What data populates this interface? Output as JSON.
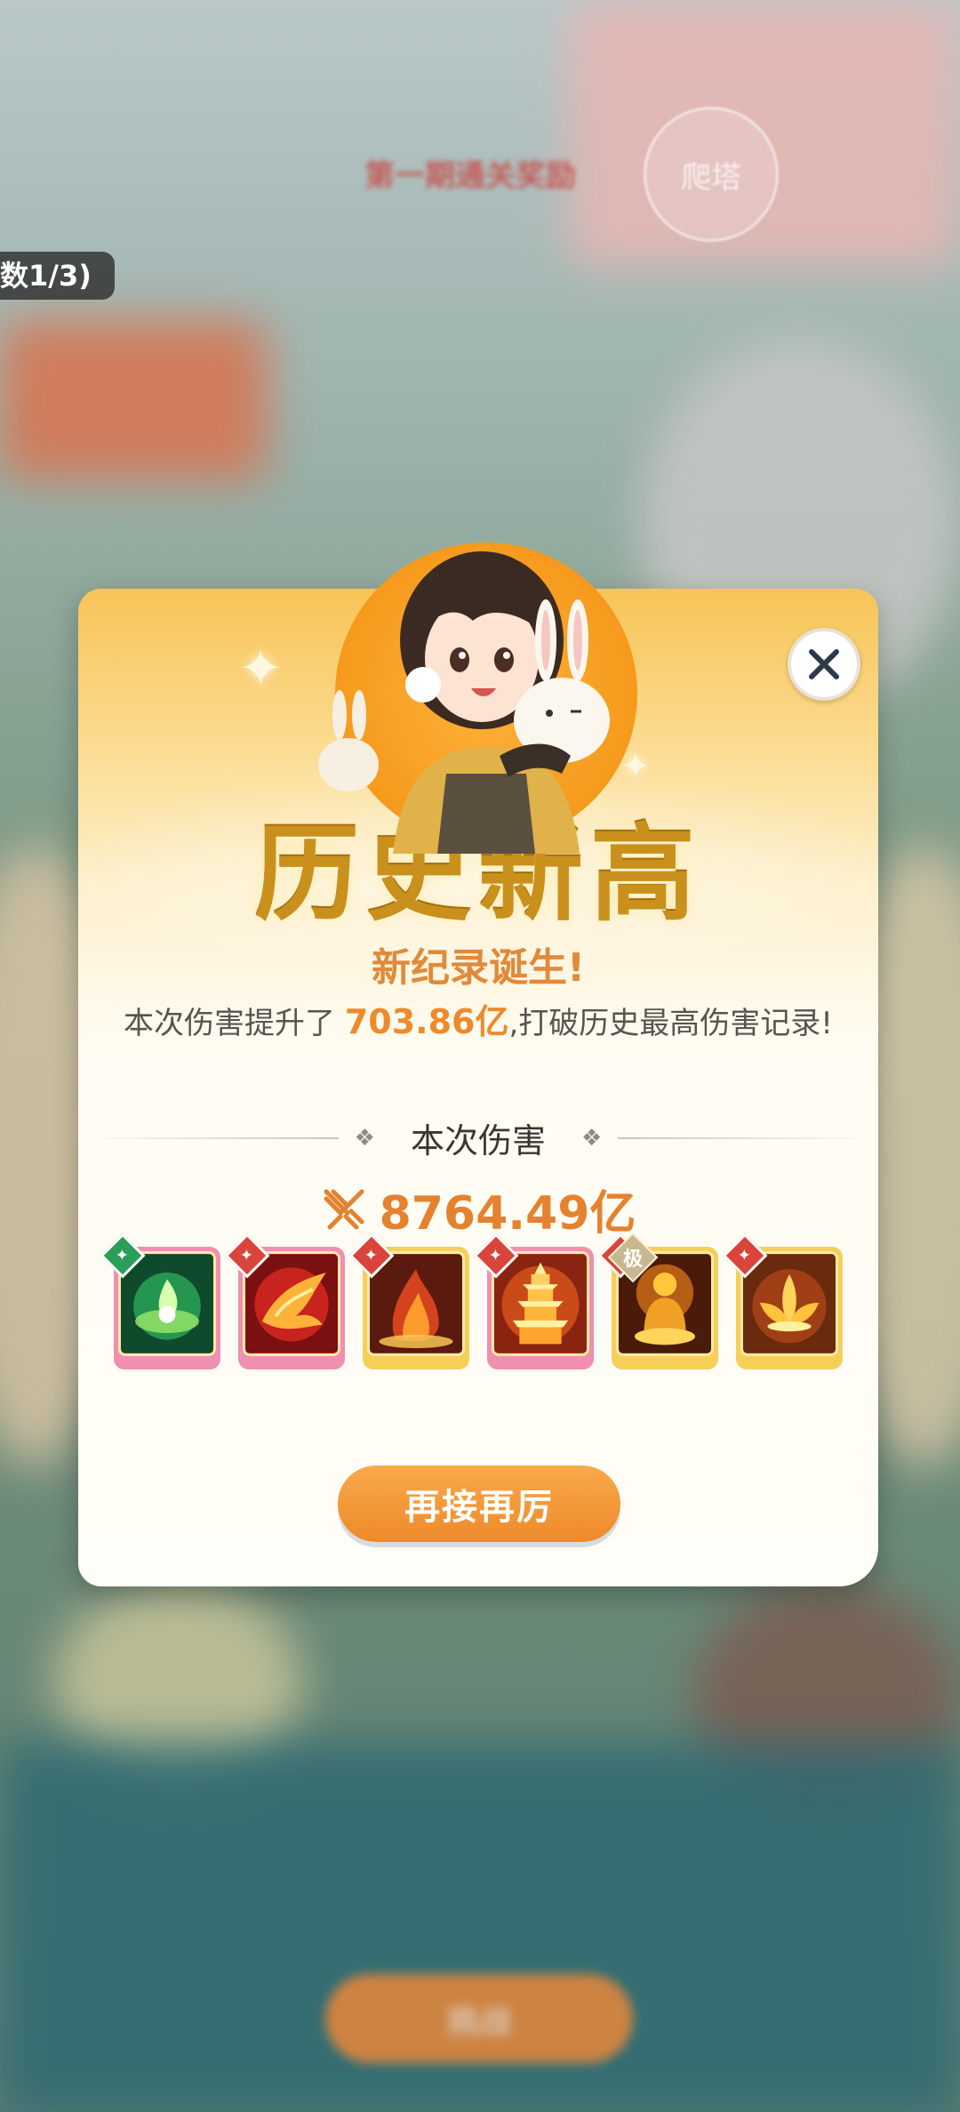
{
  "background": {
    "event_title": "第一期通关奖励",
    "climb_button": "爬塔",
    "count_chip": "数1/3)",
    "bottom_button": "挑战"
  },
  "dialog": {
    "headline": "历史新高",
    "subhead": "新纪录诞生!",
    "desc_prefix": "本次伤害提升了 ",
    "desc_highlight": "703.86亿",
    "desc_suffix": ",打破历史最高伤害记录!",
    "section_label": "本次伤害",
    "damage_value": "8764.49亿",
    "action_button": "再接再厉",
    "skills": [
      {
        "name": "green-flame",
        "frame": "pink",
        "badge": "green"
      },
      {
        "name": "fire-phoenix",
        "frame": "pink",
        "badge": "red"
      },
      {
        "name": "fire-spirit",
        "frame": "yellow",
        "badge": "red"
      },
      {
        "name": "fire-pagoda",
        "frame": "pink",
        "badge": "red"
      },
      {
        "name": "golden-buddha",
        "frame": "yellow",
        "badge": "red",
        "tier": "极"
      },
      {
        "name": "golden-lotus",
        "frame": "yellow",
        "badge": "red"
      }
    ]
  },
  "colors": {
    "accent_orange": "#ee8a2c",
    "headline_gold": "#c9901c",
    "frame_pink": "#f08fb0",
    "frame_yellow": "#f5cf58"
  }
}
